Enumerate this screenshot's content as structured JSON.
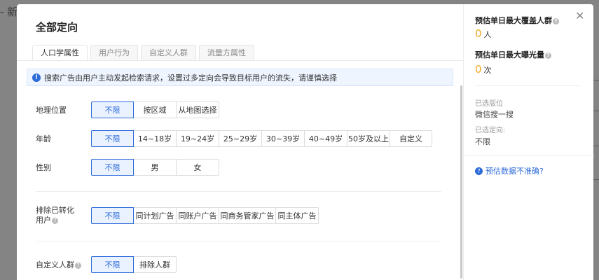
{
  "background": {
    "left_text": "- 新建"
  },
  "modal": {
    "title": "全部定向",
    "tabs": [
      "人口学属性",
      "用户行为",
      "自定义人群",
      "流量方属性"
    ],
    "notice": "搜索广告由用户主动发起检索请求，设置过多定向会导致目标用户的流失，请谨慎选择",
    "rows": {
      "geo": {
        "label": "地理位置",
        "options": [
          "不限",
          "按区域",
          "从地图选择"
        ],
        "selected": "不限"
      },
      "age": {
        "label": "年龄",
        "options": [
          "不限",
          "14~18岁",
          "19~24岁",
          "25~29岁",
          "30~39岁",
          "40~49岁",
          "50岁及以上",
          "自定义"
        ],
        "selected": "不限"
      },
      "gender": {
        "label": "性别",
        "options": [
          "不限",
          "男",
          "女"
        ],
        "selected": "不限"
      },
      "exclude": {
        "label_line1": "排除已转化",
        "label_line2": "用户",
        "options": [
          "不限",
          "同计划广告",
          "同账户广告",
          "同商务管家广告",
          "同主体广告"
        ],
        "selected": "不限"
      },
      "custom": {
        "label": "自定义人群",
        "options": [
          "不限",
          "排除人群"
        ],
        "selected": "不限"
      }
    }
  },
  "side": {
    "coverage": {
      "heading": "预估单日最大覆盖人群",
      "value": "0",
      "unit": "人"
    },
    "exposure": {
      "heading": "预估单日最大曝光量",
      "value": "0",
      "unit": "次"
    },
    "placement_label": "已选版位",
    "placement_value": "微信搜一搜",
    "targeting_label": "已选定向:",
    "targeting_value": "不限",
    "inaccurate_link": "预估数据不准确?"
  },
  "colors": {
    "accent": "#2d6bd9",
    "highlight": "#f5a623",
    "notice_bg": "#eef5ff"
  }
}
